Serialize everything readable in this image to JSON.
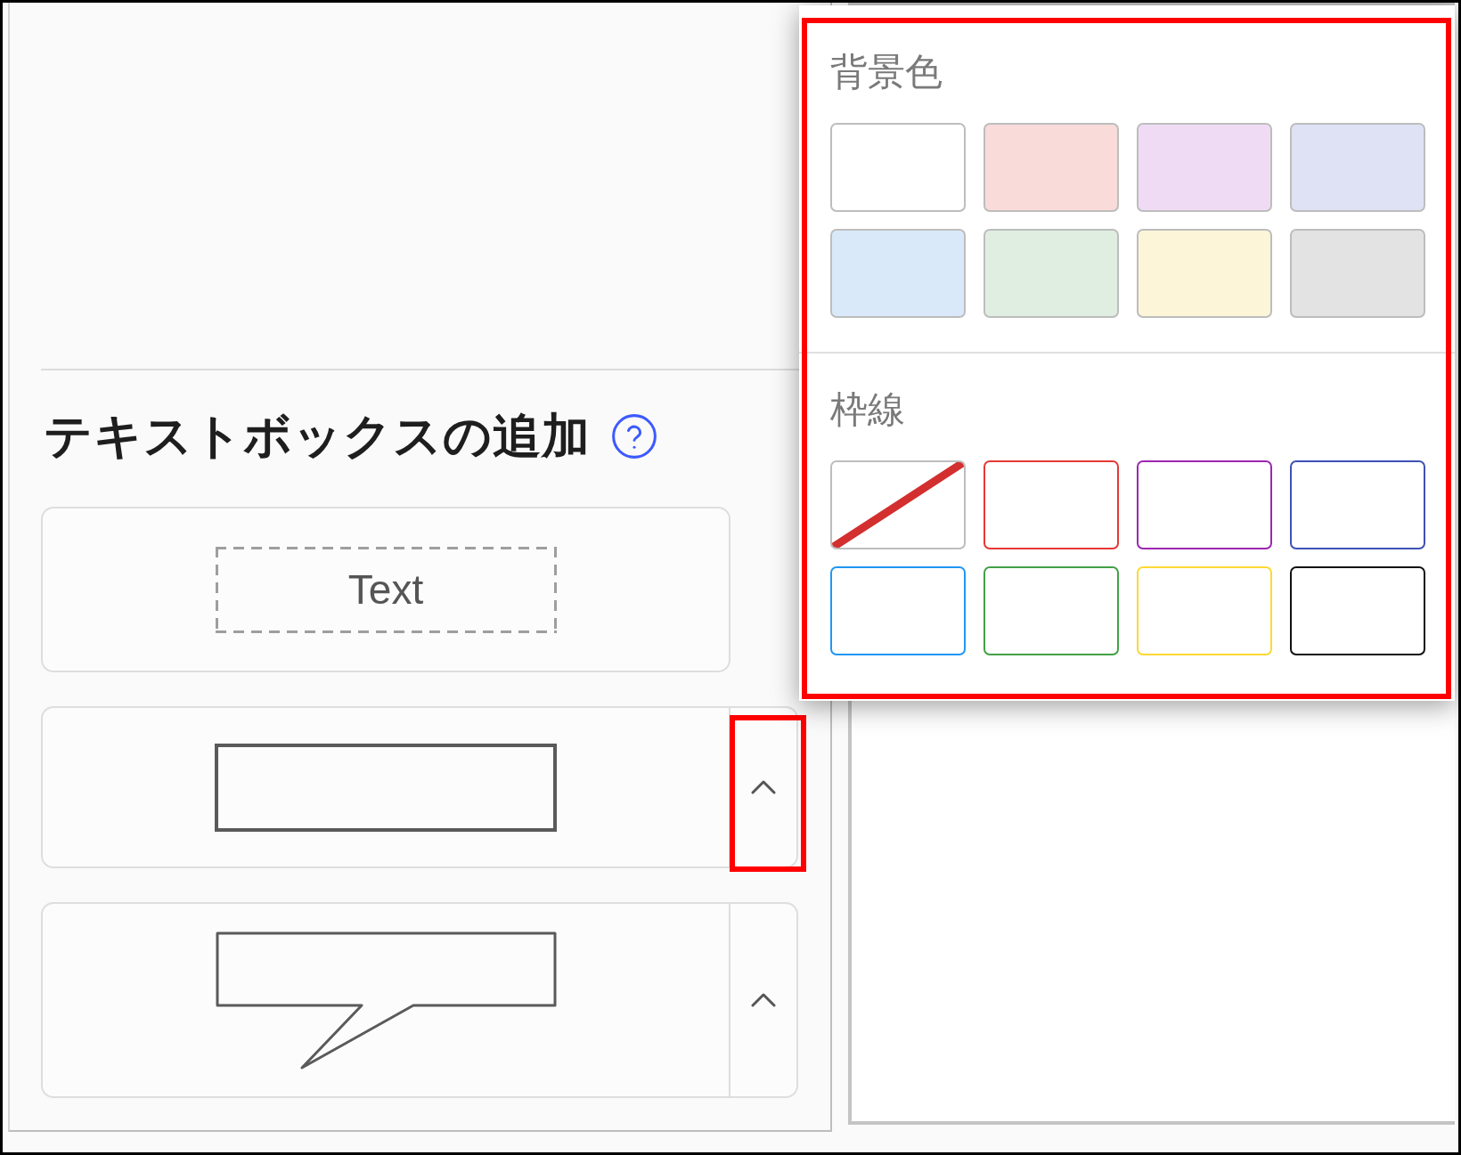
{
  "textbox_panel": {
    "title": "テキストボックスの追加",
    "styles": [
      {
        "kind": "text",
        "label": "Text",
        "menu": false
      },
      {
        "kind": "rectangle",
        "menu": true,
        "menu_highlighted": true
      },
      {
        "kind": "speech_bubble",
        "menu": true,
        "menu_highlighted": false
      }
    ]
  },
  "style_popover": {
    "highlighted": true,
    "sections": [
      {
        "title": "背景色",
        "swatches": [
          {
            "kind": "fill",
            "color": "#ffffff",
            "selected": false
          },
          {
            "kind": "fill",
            "color": "#f9dbd9",
            "selected": false
          },
          {
            "kind": "fill",
            "color": "#efdcf4",
            "selected": false
          },
          {
            "kind": "fill",
            "color": "#dfe2f4",
            "selected": false
          },
          {
            "kind": "fill",
            "color": "#d9e9f9",
            "selected": false
          },
          {
            "kind": "fill",
            "color": "#dfeee0",
            "selected": false
          },
          {
            "kind": "fill",
            "color": "#fdf5d8",
            "selected": false
          },
          {
            "kind": "fill",
            "color": "#e3e3e3",
            "selected": false
          }
        ]
      },
      {
        "title": "枠線",
        "swatches": [
          {
            "kind": "none",
            "selected": false
          },
          {
            "kind": "outline",
            "color": "#e53935",
            "selected": false
          },
          {
            "kind": "outline",
            "color": "#9c27b0",
            "selected": false
          },
          {
            "kind": "outline",
            "color": "#3f51b5",
            "selected": false
          },
          {
            "kind": "outline",
            "color": "#2196f3",
            "selected": false
          },
          {
            "kind": "outline",
            "color": "#43a047",
            "selected": false
          },
          {
            "kind": "outline",
            "color": "#fdd835",
            "selected": false
          },
          {
            "kind": "outline",
            "color": "#111111",
            "selected": false
          }
        ]
      }
    ]
  }
}
